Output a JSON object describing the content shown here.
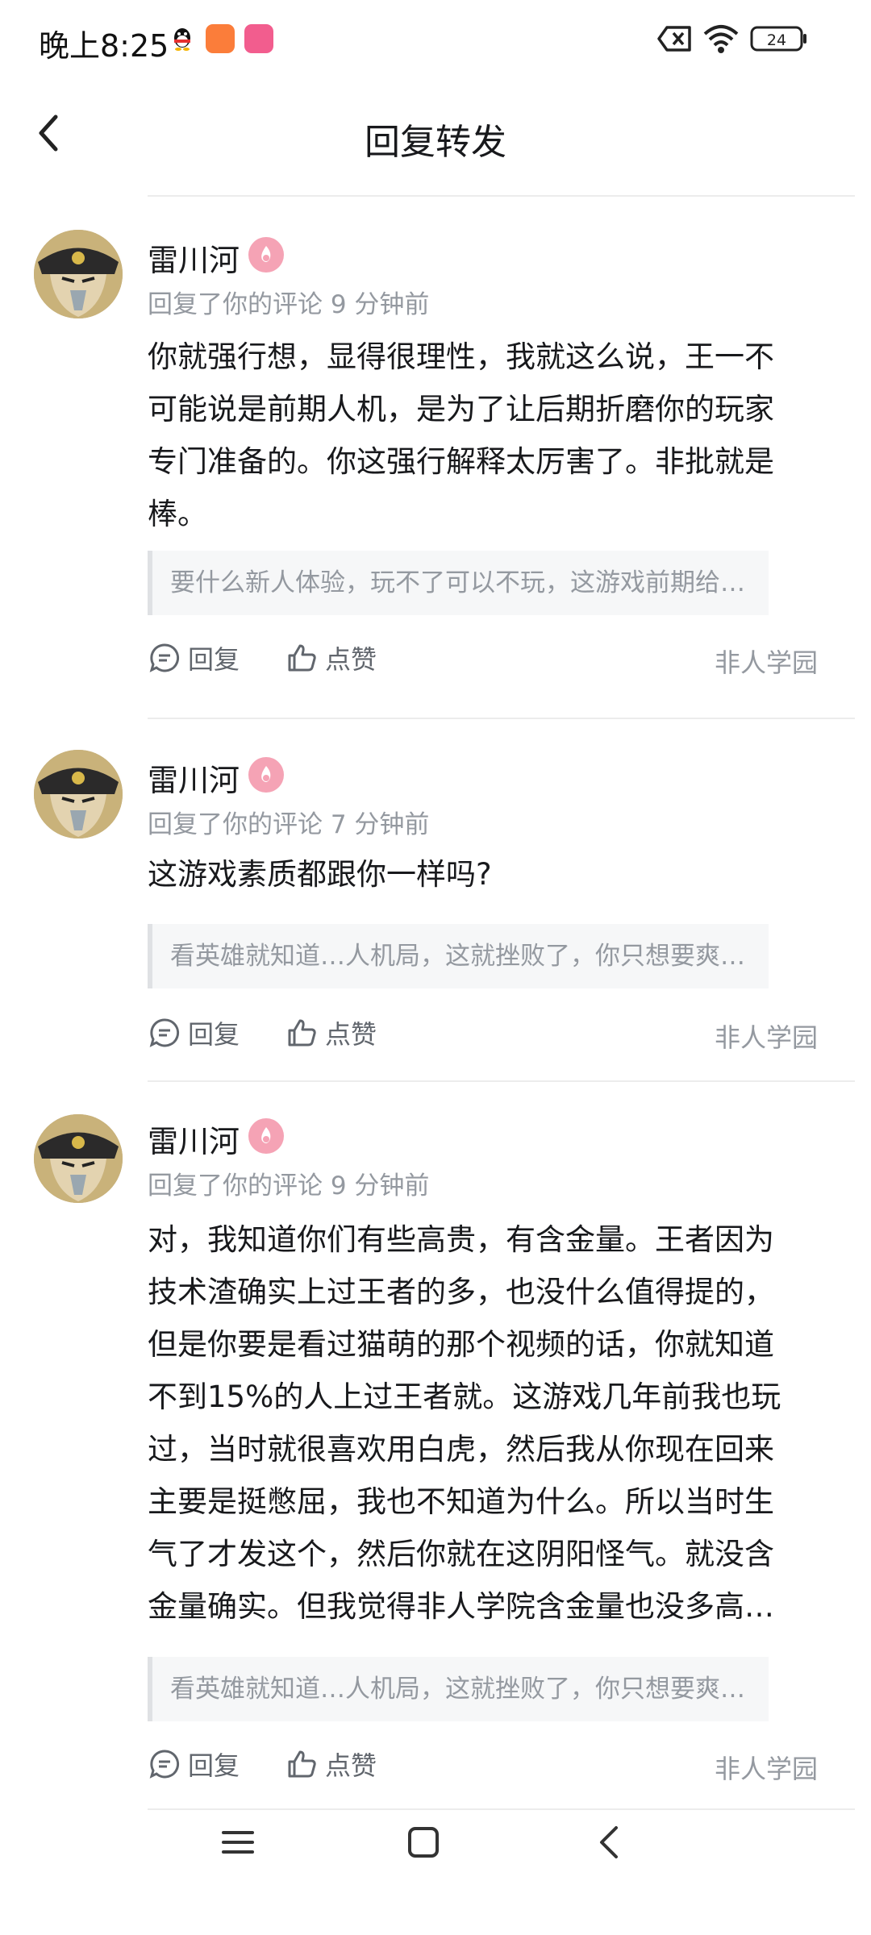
{
  "status_bar": {
    "time": "晚上8:25",
    "battery": "24"
  },
  "header": {
    "title": "回复转发"
  },
  "items": [
    {
      "username": "雷川河",
      "meta": "回复了你的评论 9 分钟前",
      "content_lines": [
        "你就强行想，显得很理性，我就这么说，王一不",
        "可能说是前期人机，是为了让后期折磨你的玩家",
        "专门准备的。你这强行解释太厉害了。非批就是",
        "棒。"
      ],
      "quote": "要什么新人体验，玩不了可以不玩，这游戏前期给…",
      "reply_label": "回复",
      "like_label": "点赞",
      "source": "非人学园"
    },
    {
      "username": "雷川河",
      "meta": "回复了你的评论 7 分钟前",
      "content_lines": [
        "这游戏素质都跟你一样吗?"
      ],
      "quote": "看英雄就知道…人机局，这就挫败了，你只想要爽…",
      "reply_label": "回复",
      "like_label": "点赞",
      "source": "非人学园"
    },
    {
      "username": "雷川河",
      "meta": "回复了你的评论 9 分钟前",
      "content_lines": [
        "对，我知道你们有些高贵，有含金量。王者因为",
        "技术渣确实上过王者的多，也没什么值得提的，",
        "但是你要是看过猫萌的那个视频的话，你就知道",
        "不到15%的人上过王者就。这游戏几年前我也玩",
        "过，当时就很喜欢用白虎，然后我从你现在回来",
        "主要是挺憋屈，我也不知道为什么。所以当时生",
        "气了才发这个，然后你就在这阴阳怪气。就没含",
        "金量确实。但我觉得非人学院含金量也没多高…"
      ],
      "quote": "看英雄就知道…人机局，这就挫败了，你只想要爽…",
      "reply_label": "回复",
      "like_label": "点赞",
      "source": "非人学园"
    }
  ],
  "colors": {
    "text": "#18191c",
    "secondary": "#9499a0",
    "divider": "#ececec",
    "badge": "#f5a3b5"
  },
  "icons": [
    "qq-icon",
    "app-icon",
    "bilibili-icon",
    "sim-off-icon",
    "wifi-icon",
    "battery-icon",
    "back-arrow-icon",
    "level-badge-icon",
    "reply-icon",
    "thumbs-up-icon",
    "menu-icon",
    "home-icon",
    "back-nav-icon"
  ]
}
